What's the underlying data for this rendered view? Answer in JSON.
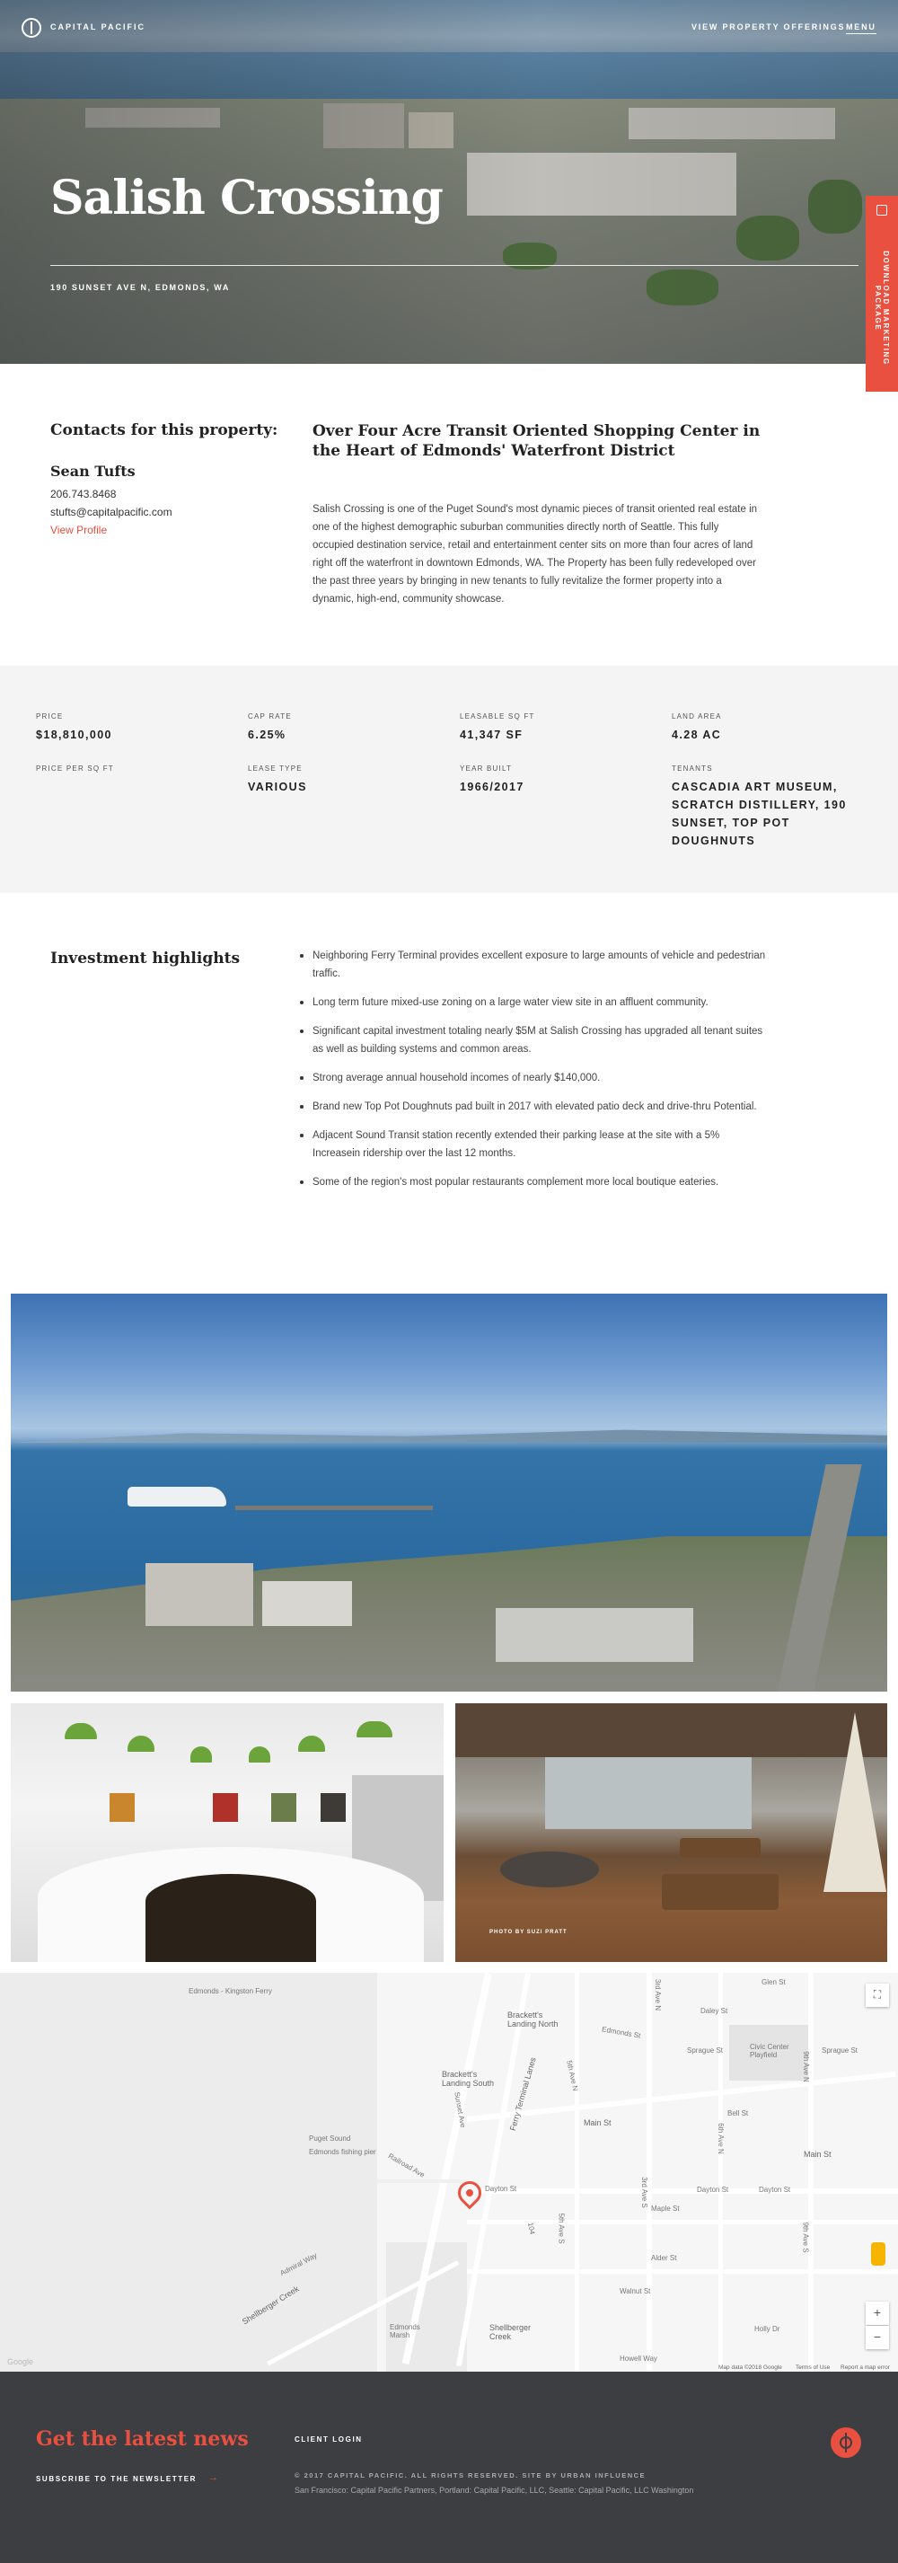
{
  "header": {
    "brand": "CAPITAL PACIFIC",
    "nav_offerings": "VIEW PROPERTY OFFERINGS",
    "nav_menu": "MENU"
  },
  "hero": {
    "title": "Salish Crossing",
    "address": "190 SUNSET AVE N, EDMONDS, WA",
    "download_tab": "DOWNLOAD MARKETING PACKAGE"
  },
  "contacts": {
    "heading": "Contacts for this property:",
    "name": "Sean Tufts",
    "phone": "206.743.8468",
    "email": "stufts@capitalpacific.com",
    "profile_link": "View Profile"
  },
  "intro": {
    "heading": "Over Four Acre Transit Oriented Shopping Center in the Heart of Edmonds' Waterfront District",
    "body": "Salish Crossing is one of the Puget Sound's most dynamic pieces of transit oriented real estate in one of the highest demographic suburban communities directly north of Seattle. This fully occupied destination service, retail and entertainment center sits on more than four acres of land right off the waterfront in downtown Edmonds, WA. The Property has been fully redeveloped over the past three years by bringing in new tenants to fully revitalize the former property into a dynamic, high-end, community showcase."
  },
  "stats": [
    {
      "label": "PRICE",
      "value": "$18,810,000"
    },
    {
      "label": "CAP RATE",
      "value": "6.25%"
    },
    {
      "label": "LEASABLE SQ FT",
      "value": "41,347 SF"
    },
    {
      "label": "LAND AREA",
      "value": "4.28 AC"
    },
    {
      "label": "PRICE PER SQ FT",
      "value": ""
    },
    {
      "label": "LEASE TYPE",
      "value": "VARIOUS"
    },
    {
      "label": "YEAR BUILT",
      "value": "1966/2017"
    },
    {
      "label": "TENANTS",
      "value": "CASCADIA ART MUSEUM, SCRATCH DISTILLERY, 190 SUNSET, TOP POT DOUGHNUTS"
    }
  ],
  "highlights": {
    "heading": "Investment highlights",
    "items": [
      "Neighboring Ferry Terminal provides excellent exposure to large amounts of vehicle and pedestrian traffic.",
      "Long term future mixed-use zoning on a large water view site in an affluent community.",
      "Significant capital investment totaling nearly $5M at Salish Crossing has upgraded all tenant suites as well as building systems and common areas.",
      "Strong average annual household incomes of nearly $140,000.",
      "Brand new Top Pot Doughnuts pad built in 2017 with elevated patio deck and drive-thru Potential.",
      "Adjacent Sound Transit station recently extended their parking lease at the site with a 5% Increasein ridership over the last 12 months.",
      "Some of the region's most popular restaurants complement more local boutique eateries."
    ]
  },
  "photos": {
    "credit": "PHOTO BY SUZI PRATT"
  },
  "map": {
    "labels": {
      "ferry": "Edmonds - Kingston Ferry",
      "brackett_north": "Brackett's Landing North",
      "brackett_south": "Brackett's Landing South",
      "civic": "Civic Center Playfield",
      "puget": "Puget Sound",
      "pier": "Edmonds fishing pier",
      "marsh": "Edmonds Marsh",
      "creek": "Shellberger Creek",
      "dayton": "Dayton St",
      "main": "Main St",
      "bell": "Bell St",
      "walnut": "Walnut St",
      "maple": "Maple St",
      "alder": "Alder St",
      "howell": "Howell Way",
      "holly": "Holly Dr",
      "sprague": "Sprague St",
      "edmonds_st": "Edmonds St",
      "daley": "Daley St",
      "glen": "Glen St",
      "admiral": "Admiral Way",
      "railroad": "Railroad Ave",
      "sunset": "Sunset Ave",
      "shellberger_cr": "Shellberger Creek",
      "ferry_terminal": "Ferry Terminal Lanes",
      "third_ave_n": "3rd Ave N",
      "third_ave_s": "3rd Ave S",
      "fifth_ave_n": "5th Ave N",
      "fifth_ave_s": "5th Ave S",
      "sixth_ave_n": "6th Ave N",
      "ninth_ave_n": "9th Ave N",
      "ninth_ave_s": "9th Ave S",
      "sr104": "104"
    },
    "footer_data": "Map data ©2018 Google",
    "footer_terms": "Terms of Use",
    "footer_report": "Report a map error",
    "google": "Google",
    "zoom_in": "+",
    "zoom_out": "−"
  },
  "footer": {
    "news_heading": "Get the latest news",
    "subscribe": "SUBSCRIBE TO THE NEWSLETTER",
    "client_login": "CLIENT LOGIN",
    "copyright": "© 2017 CAPITAL PACIFIC. ALL RIGHTS RESERVED. SITE BY URBAN INFLUENCE",
    "offices": "San Francisco: Capital Pacific Partners, Portland: Capital Pacific, LLC, Seattle: Capital Pacific, LLC Washington"
  },
  "colors": {
    "accent": "#e9503f",
    "footer_bg": "#3d3e42",
    "stats_bg": "#f4f4f5"
  }
}
